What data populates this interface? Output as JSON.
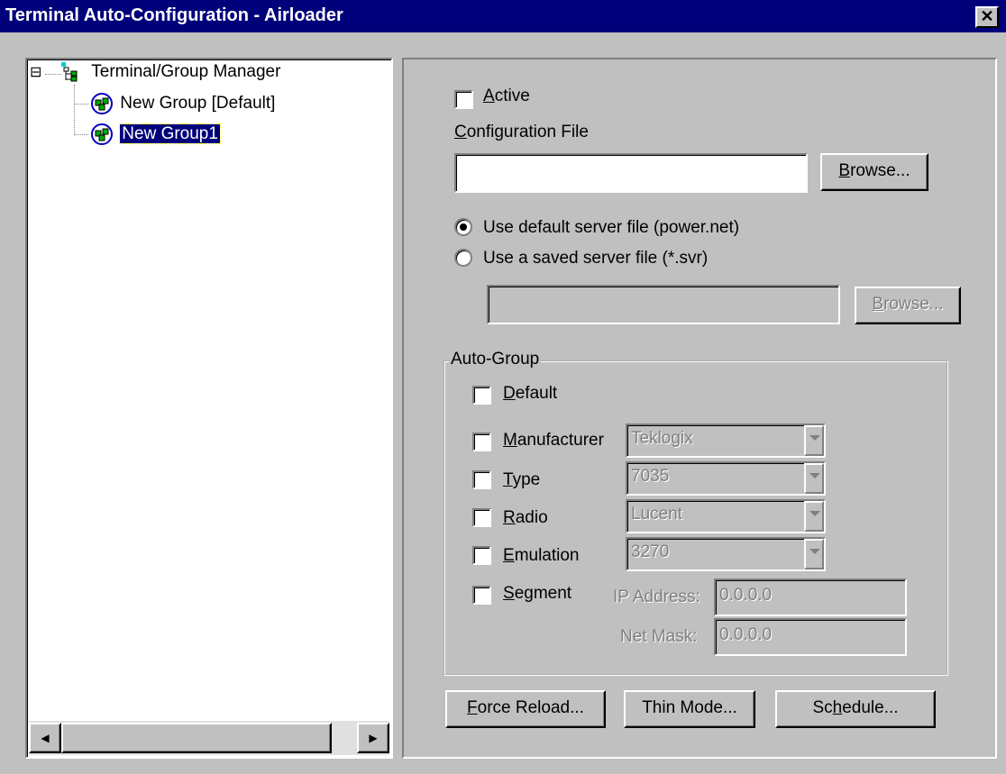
{
  "window": {
    "title": "Terminal Auto-Configuration - Airloader",
    "close_glyph": "✕"
  },
  "tree": {
    "root": {
      "label": "Terminal/Group Manager",
      "expander": "⊟",
      "icon": "tree-manager-icon"
    },
    "items": [
      {
        "label": "New Group [Default]",
        "icon": "group-icon",
        "selected": false
      },
      {
        "label": "New Group1",
        "icon": "group-icon",
        "selected": true
      }
    ],
    "scroll_left_glyph": "◀",
    "scroll_right_glyph": "▶"
  },
  "config": {
    "active_label_u": "A",
    "active_label_rest": "ctive",
    "active_checked": false,
    "config_file_label_u": "C",
    "config_file_label_rest": "onfiguration File",
    "config_file_value": "",
    "browse_u": "B",
    "browse_rest": "rowse...",
    "radio_default_label": "Use default server file (power.net)",
    "radio_saved_label": "Use a saved server file (*.svr)",
    "selected_radio": "default",
    "saved_file_value": "",
    "browse2_u": "B",
    "browse2_rest": "rowse..."
  },
  "auto_group": {
    "legend": "Auto-Group",
    "default_u": "D",
    "default_rest": "efault",
    "manufacturer_u": "M",
    "manufacturer_rest": "anufacturer",
    "manufacturer_value": "Teklogix",
    "type_u": "T",
    "type_rest": "ype",
    "type_value": "7035",
    "radio_u": "R",
    "radio_rest": "adio",
    "radio_value": "Lucent",
    "emulation_u": "E",
    "emulation_rest": "mulation",
    "emulation_value": "3270",
    "segment_u": "S",
    "segment_rest": "egment",
    "ip_label": "IP Address:",
    "ip_value": "0.0.0.0",
    "mask_label": "Net Mask:",
    "mask_value": "0.0.0.0"
  },
  "buttons": {
    "force_reload_u": "F",
    "force_reload_rest": "orce Reload...",
    "thin_mode": "Thin Mode...",
    "schedule_pre": "Sc",
    "schedule_u": "h",
    "schedule_rest": "edule..."
  },
  "colors": {
    "titlebar": "#00007b",
    "face": "#c0c0c0",
    "selection": "#00007b"
  }
}
